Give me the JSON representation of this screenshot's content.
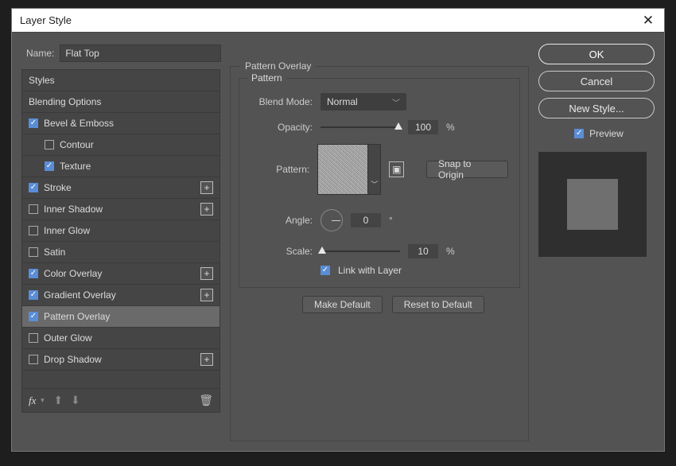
{
  "dialog": {
    "title": "Layer Style",
    "name_label": "Name:",
    "name_value": "Flat Top"
  },
  "styles": {
    "header": "Styles",
    "blending_options": "Blending Options",
    "items": [
      {
        "label": "Bevel & Emboss",
        "checked": true,
        "add": false,
        "sub": false
      },
      {
        "label": "Contour",
        "checked": false,
        "add": false,
        "sub": true
      },
      {
        "label": "Texture",
        "checked": true,
        "add": false,
        "sub": true
      },
      {
        "label": "Stroke",
        "checked": true,
        "add": true,
        "sub": false
      },
      {
        "label": "Inner Shadow",
        "checked": false,
        "add": true,
        "sub": false
      },
      {
        "label": "Inner Glow",
        "checked": false,
        "add": false,
        "sub": false
      },
      {
        "label": "Satin",
        "checked": false,
        "add": false,
        "sub": false
      },
      {
        "label": "Color Overlay",
        "checked": true,
        "add": true,
        "sub": false
      },
      {
        "label": "Gradient Overlay",
        "checked": true,
        "add": true,
        "sub": false
      },
      {
        "label": "Pattern Overlay",
        "checked": true,
        "add": false,
        "sub": false,
        "selected": true
      },
      {
        "label": "Outer Glow",
        "checked": false,
        "add": false,
        "sub": false
      },
      {
        "label": "Drop Shadow",
        "checked": false,
        "add": true,
        "sub": false
      }
    ],
    "fx_label": "fx"
  },
  "pattern_overlay": {
    "panel_title": "Pattern Overlay",
    "group_title": "Pattern",
    "blend_mode_label": "Blend Mode:",
    "blend_mode_value": "Normal",
    "opacity_label": "Opacity:",
    "opacity_value": "100",
    "opacity_unit": "%",
    "pattern_label": "Pattern:",
    "snap_button": "Snap to Origin",
    "angle_label": "Angle:",
    "angle_value": "0",
    "angle_unit": "°",
    "scale_label": "Scale:",
    "scale_value": "10",
    "scale_unit": "%",
    "link_label": "Link with Layer",
    "make_default": "Make Default",
    "reset_default": "Reset to Default"
  },
  "right": {
    "ok": "OK",
    "cancel": "Cancel",
    "new_style": "New Style...",
    "preview": "Preview"
  }
}
